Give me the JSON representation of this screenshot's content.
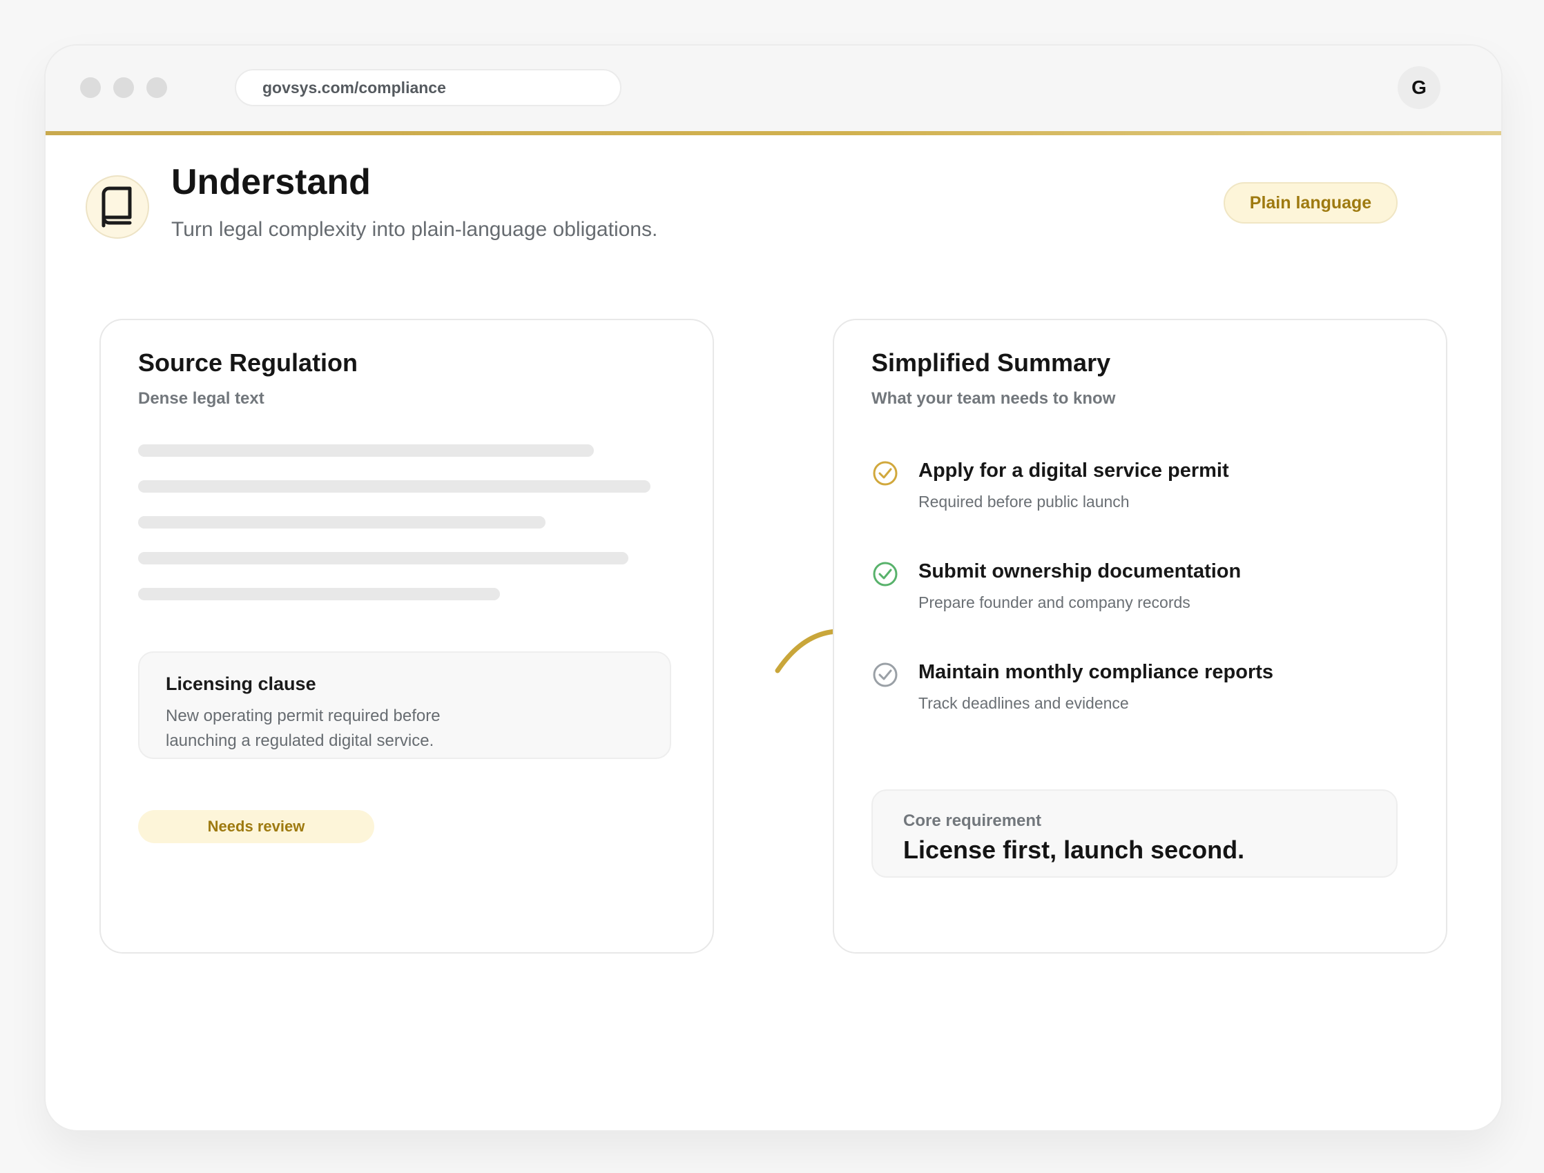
{
  "browser": {
    "url": "govsys.com/compliance",
    "avatar_initial": "G"
  },
  "header": {
    "icon": "book-icon",
    "title": "Understand",
    "subtitle": "Turn legal complexity into plain-language obligations.",
    "badge": "Plain language"
  },
  "source_card": {
    "title": "Source Regulation",
    "subtitle": "Dense legal text",
    "clause": {
      "title": "Licensing clause",
      "text": "New operating permit required before launching a regulated digital service."
    },
    "status_badge": "Needs review"
  },
  "summary_card": {
    "title": "Simplified Summary",
    "subtitle": "What your team needs to know",
    "items": [
      {
        "title": "Apply for a digital service permit",
        "description": "Required before public launch",
        "icon": "check-circle-icon",
        "color": "#d1a83c"
      },
      {
        "title": "Submit ownership documentation",
        "description": "Prepare founder and company records",
        "icon": "check-circle-icon",
        "color": "#58b26b"
      },
      {
        "title": "Maintain monthly compliance reports",
        "description": "Track deadlines and evidence",
        "icon": "check-circle-icon",
        "color": "#9aa0a6"
      }
    ],
    "core": {
      "label": "Core requirement",
      "text": "License first, launch second."
    }
  },
  "colors": {
    "accent": "#d1b14f",
    "badge_text": "#9e7a10",
    "badge_bg": "#fdf5d9"
  }
}
